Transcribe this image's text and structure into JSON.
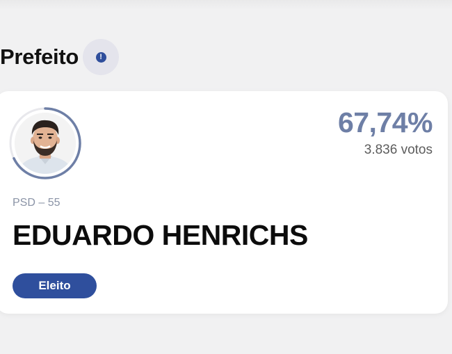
{
  "section": {
    "title": "Prefeito",
    "info_icon": "info-icon",
    "info_glyph": "!"
  },
  "candidate": {
    "percent": "67,74%",
    "percent_value": 67.74,
    "votes": "3.836 votos",
    "party": "PSD – 55",
    "name": "EDUARDO HENRICHS",
    "status": "Eleito",
    "avatar": "candidate-photo"
  },
  "colors": {
    "accent": "#2f4f9d",
    "percent": "#6e7fa6",
    "ring": "#6e7fa6",
    "background": "#f1f1f2"
  }
}
